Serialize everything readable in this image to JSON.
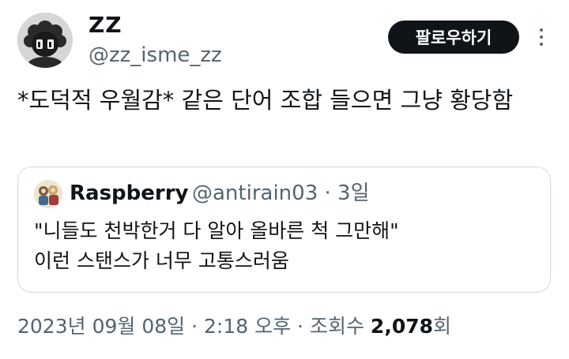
{
  "author": {
    "name": "ZZ",
    "handle": "@zz_isme_zz",
    "follow_label": "팔로우하기"
  },
  "tweet": {
    "text": "*도덕적 우월감* 같은 단어 조합 들으면 그냥 황당함"
  },
  "quote": {
    "author_name": "Raspberry",
    "author_handle": "@antirain03",
    "separator": "·",
    "time": "3일",
    "lines": [
      "\"니들도 천박한거 다 알아 올바른 척 그만해\"",
      "이런 스탠스가 너무 고통스러움"
    ]
  },
  "footer": {
    "date": "2023년 09월 08일",
    "sep1": "·",
    "time": "2:18 오후",
    "sep2": "·",
    "views_label": "조회수",
    "views_count": "2,078",
    "views_suffix": "회"
  },
  "colors": {
    "text_primary": "#0f1419",
    "text_secondary": "#536471",
    "border": "#cfd9de",
    "button_bg": "#0f1419"
  },
  "icons": {
    "more": "more-dots-icon"
  }
}
